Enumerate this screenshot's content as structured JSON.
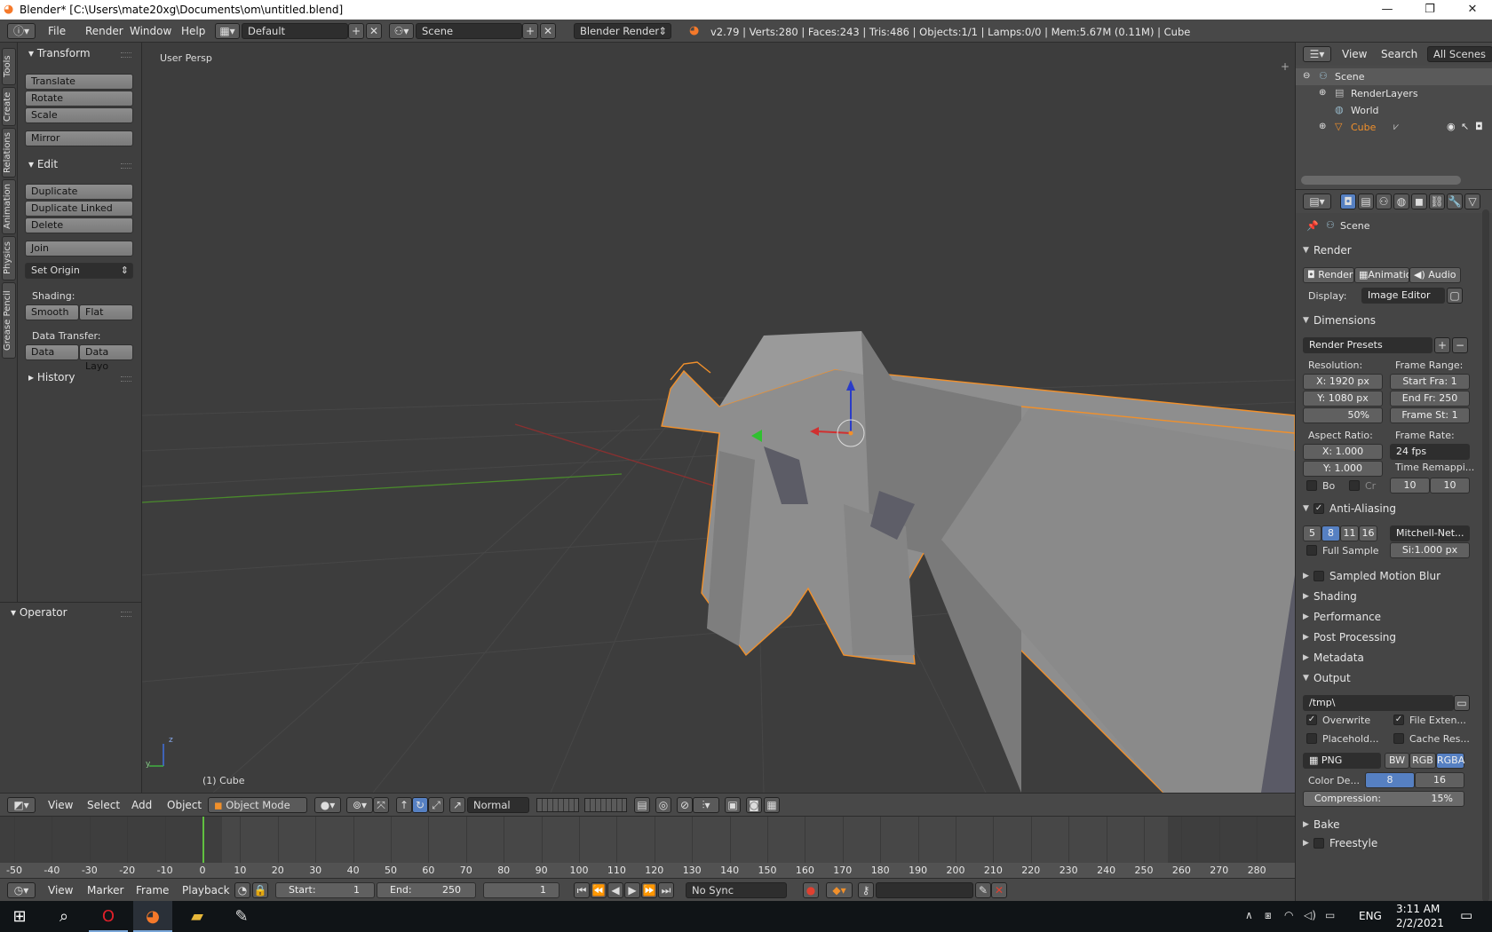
{
  "title_bar": {
    "title": "Blender* [C:\\Users\\mate20xg\\Documents\\om\\untitled.blend]",
    "minimize": "—",
    "maximize": "❐",
    "close": "✕"
  },
  "top_menu": {
    "items": [
      "File",
      "Render",
      "Window",
      "Help"
    ],
    "layout": "Default",
    "scene": "Scene",
    "engine": "Blender Render",
    "stats": "v2.79 | Verts:280 | Faces:243 | Tris:486 | Objects:1/1 | Lamps:0/0 | Mem:5.67M (0.11M) | Cube"
  },
  "left_tabs": [
    "Tools",
    "Create",
    "Relations",
    "Animation",
    "Physics",
    "Grease Pencil"
  ],
  "tool_shelf": {
    "transform_header": "Transform",
    "translate": "Translate",
    "rotate": "Rotate",
    "scale": "Scale",
    "mirror": "Mirror",
    "edit_header": "Edit",
    "duplicate": "Duplicate",
    "duplicate_linked": "Duplicate Linked",
    "delete": "Delete",
    "join": "Join",
    "set_origin": "Set Origin",
    "shading_label": "Shading:",
    "smooth": "Smooth",
    "flat": "Flat",
    "data_transfer_label": "Data Transfer:",
    "data": "Data",
    "data_layo": "Data Layo",
    "history_header": "History"
  },
  "operator": {
    "header": "Operator"
  },
  "viewport": {
    "persp_label": "User Persp",
    "object_label": "(1) Cube",
    "axis_z": "z",
    "axis_y": "y"
  },
  "viewport_header": {
    "menus": [
      "View",
      "Select",
      "Add",
      "Object"
    ],
    "mode": "Object Mode",
    "orientation": "Normal"
  },
  "timeline": {
    "ticks": [
      "-50",
      "-40",
      "-30",
      "-20",
      "-10",
      "0",
      "10",
      "20",
      "30",
      "40",
      "50",
      "60",
      "70",
      "80",
      "90",
      "100",
      "110",
      "120",
      "130",
      "140",
      "150",
      "160",
      "170",
      "180",
      "190",
      "200",
      "210",
      "220",
      "230",
      "240",
      "250",
      "260",
      "270",
      "280"
    ],
    "current_frame_fraction": 0.154
  },
  "timeline_footer": {
    "menus": [
      "View",
      "Marker",
      "Frame",
      "Playback"
    ],
    "start_label": "Start:",
    "start_value": "1",
    "end_label": "End:",
    "end_value": "250",
    "current": "1",
    "sync": "No Sync"
  },
  "outliner": {
    "view": "View",
    "search": "Search",
    "all_scenes": "All Scenes",
    "items": {
      "scene": "Scene",
      "render_layers": "RenderLayers",
      "world": "World",
      "cube": "Cube"
    }
  },
  "properties": {
    "context": "Scene",
    "render_header": "Render",
    "render_btn": "Render",
    "animation_btn": "Animatio",
    "audio_btn": "Audio",
    "display_label": "Display:",
    "display_value": "Image Editor",
    "dimensions_header": "Dimensions",
    "render_presets": "Render Presets",
    "resolution_label": "Resolution:",
    "res_x": "X: 1920 px",
    "res_y": "Y: 1080 px",
    "res_pct": "50%",
    "frame_range_label": "Frame Range:",
    "start_frame": "Start Fra: 1",
    "end_frame": "End Fr: 250",
    "frame_step": "Frame St: 1",
    "aspect_label": "Aspect Ratio:",
    "aspect_x": "X:     1.000",
    "aspect_y": "Y:     1.000",
    "frame_rate_label": "Frame Rate:",
    "frame_rate": "24 fps",
    "time_remap_label": "Time Remappi...",
    "remap_old": "10",
    "remap_new": "10",
    "border": "Bo",
    "crop": "Cr",
    "aa_header": "Anti-Aliasing",
    "aa_samples": [
      "5",
      "8",
      "11",
      "16"
    ],
    "aa_filter": "Mitchell-Net...",
    "full_sample": "Full Sample",
    "filter_size": "Si:1.000 px",
    "collapsed": [
      "Sampled Motion Blur",
      "Shading",
      "Performance",
      "Post Processing",
      "Metadata"
    ],
    "output_header": "Output",
    "output_path": "/tmp\\",
    "overwrite": "Overwrite",
    "file_ext": "File Exten...",
    "placeholders": "Placehold...",
    "cache_result": "Cache Res...",
    "format": "PNG",
    "bw": "BW",
    "rgb": "RGB",
    "rgba": "RGBA",
    "color_depth_label": "Color De...",
    "depth_8": "8",
    "depth_16": "16",
    "compression": "Compression:",
    "compression_value": "15%",
    "bake_header": "Bake",
    "freestyle_header": "Freestyle"
  },
  "taskbar": {
    "lang": "ENG",
    "time": "3:11 AM",
    "date": "2/2/2021"
  },
  "colors": {
    "accent_blue": "#5680c2",
    "selection_orange": "#f1902b",
    "frame_cursor": "#60c040"
  }
}
